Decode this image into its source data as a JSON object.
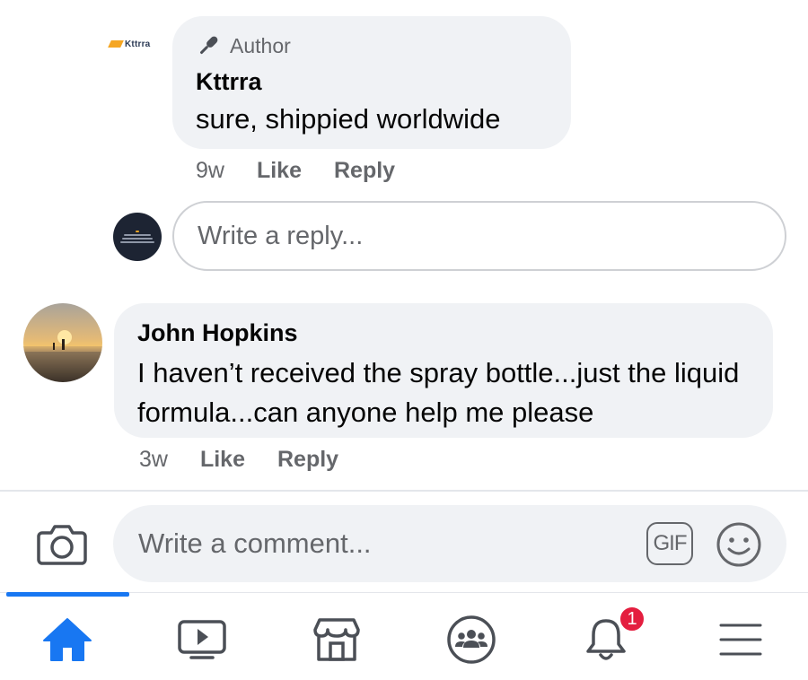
{
  "colors": {
    "accent": "#1877f2",
    "secondary_text": "#65676b",
    "bubble_bg": "#f0f2f5",
    "badge_red": "#e41e3f"
  },
  "author_reply": {
    "avatar_text": "Kttrra",
    "badge_icon": "microphone-icon",
    "badge_label": "Author",
    "name": "Kttrra",
    "text": "sure, shippied worldwide",
    "time": "9w",
    "like_label": "Like",
    "reply_label": "Reply"
  },
  "reply_input": {
    "placeholder": "Write a reply..."
  },
  "comment": {
    "name": "John Hopkins",
    "text": "I haven’t received the spray bottle...just the liquid formula...can anyone help me please",
    "time": "3w",
    "like_label": "Like",
    "reply_label": "Reply"
  },
  "composer": {
    "placeholder": "Write a comment...",
    "gif_label": "GIF",
    "camera_icon": "camera-icon",
    "emoji_icon": "emoji-icon"
  },
  "bottom_nav": {
    "tabs": [
      {
        "icon": "home-icon",
        "active": true
      },
      {
        "icon": "watch-icon",
        "active": false
      },
      {
        "icon": "marketplace-icon",
        "active": false
      },
      {
        "icon": "groups-icon",
        "active": false
      },
      {
        "icon": "notifications-icon",
        "active": false
      },
      {
        "icon": "menu-icon",
        "active": false
      }
    ],
    "notification_count": "1"
  }
}
